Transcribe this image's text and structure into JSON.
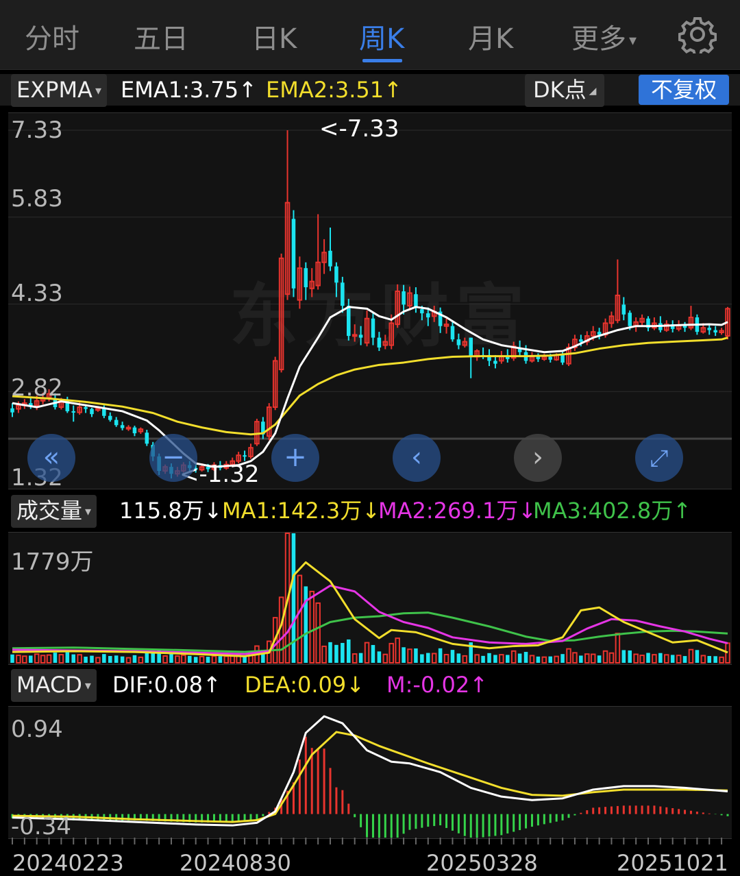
{
  "tabs": [
    {
      "label": "分时",
      "active": false
    },
    {
      "label": "五日",
      "active": false
    },
    {
      "label": "日K",
      "active": false
    },
    {
      "label": "周K",
      "active": true
    },
    {
      "label": "月K",
      "active": false
    },
    {
      "label": "更多",
      "active": false
    }
  ],
  "tab_more_caret": "▾",
  "settings_icon": "gear-icon",
  "main_indicator": {
    "name": "EXPMA",
    "caret": "▾",
    "ema1": "EMA1:3.75",
    "ema1_arrow": "↑",
    "ema2": "EMA2:3.51",
    "ema2_arrow": "↑",
    "dk_label": "DK点",
    "dk_caret": "◢",
    "fq_label": "不复权"
  },
  "price_axis": [
    "7.33",
    "5.83",
    "4.33",
    "2.82",
    "1.32"
  ],
  "high_marker": "<-7.33",
  "low_marker": "<-1.32",
  "watermark": "东方财富",
  "volume_indicator": {
    "name": "成交量",
    "caret": "▾",
    "value": "115.8万",
    "value_arrow": "↓",
    "ma1": "MA1:142.3万",
    "ma1_arrow": "↓",
    "ma2": "MA2:269.1万",
    "ma2_arrow": "↓",
    "ma3": "MA3:402.8万",
    "ma3_arrow": "↑"
  },
  "volume_axis_max": "1779万",
  "macd_indicator": {
    "name": "MACD",
    "caret": "▾",
    "dif": "DIF:0.08",
    "dif_arrow": "↑",
    "dea": "DEA:0.09",
    "dea_arrow": "↓",
    "m": "M:-0.02",
    "m_arrow": "↑"
  },
  "macd_axis": [
    "0.94",
    "-0.34"
  ],
  "x_axis": [
    "20240223",
    "20240830",
    "20250328",
    "20251021"
  ],
  "colors": {
    "up": "#e8342e",
    "down": "#1ce4f0",
    "ema1": "#ffffff",
    "ema2": "#f2de2c",
    "ma2": "#e535e5",
    "ma3": "#3fc24a",
    "accent": "#3a7ee8"
  },
  "chart_data": {
    "type": "candlestick",
    "period": "weekly",
    "ylim": [
      1.32,
      7.33
    ],
    "candles": [
      [
        2.53,
        2.46,
        2.62,
        2.38
      ],
      [
        2.52,
        2.58,
        2.65,
        2.45
      ],
      [
        2.58,
        2.62,
        2.69,
        2.52
      ],
      [
        2.62,
        2.58,
        2.72,
        2.52
      ],
      [
        2.58,
        2.66,
        2.75,
        2.5
      ],
      [
        2.66,
        2.71,
        2.8,
        2.6
      ],
      [
        2.71,
        2.78,
        2.86,
        2.65
      ],
      [
        2.7,
        2.55,
        2.79,
        2.51
      ],
      [
        2.55,
        2.66,
        2.71,
        2.51
      ],
      [
        2.66,
        2.48,
        2.73,
        2.45
      ],
      [
        2.48,
        2.46,
        2.58,
        2.3
      ],
      [
        2.46,
        2.55,
        2.63,
        2.42
      ],
      [
        2.55,
        2.52,
        2.6,
        2.45
      ],
      [
        2.52,
        2.43,
        2.54,
        2.38
      ],
      [
        2.5,
        2.53,
        2.57,
        2.47
      ],
      [
        2.53,
        2.4,
        2.58,
        2.36
      ],
      [
        2.4,
        2.33,
        2.46,
        2.3
      ],
      [
        2.33,
        2.24,
        2.38,
        2.21
      ],
      [
        2.24,
        2.19,
        2.3,
        2.15
      ],
      [
        2.18,
        2.2,
        2.24,
        2.14
      ],
      [
        2.2,
        2.1,
        2.23,
        2.05
      ],
      [
        2.13,
        2.17,
        2.2,
        2.09
      ],
      [
        2.11,
        1.92,
        2.16,
        1.88
      ],
      [
        1.9,
        1.7,
        1.95,
        1.62
      ],
      [
        1.7,
        1.45,
        1.75,
        1.38
      ],
      [
        1.45,
        1.52,
        1.56,
        1.4
      ],
      [
        1.52,
        1.4,
        1.58,
        1.32
      ],
      [
        1.4,
        1.45,
        1.52,
        1.35
      ],
      [
        1.45,
        1.55,
        1.6,
        1.42
      ],
      [
        1.55,
        1.5,
        1.62,
        1.44
      ],
      [
        1.5,
        1.47,
        1.56,
        1.42
      ],
      [
        1.47,
        1.52,
        1.58,
        1.44
      ],
      [
        1.52,
        1.48,
        1.57,
        1.43
      ],
      [
        1.48,
        1.55,
        1.6,
        1.45
      ],
      [
        1.55,
        1.5,
        1.62,
        1.46
      ],
      [
        1.5,
        1.56,
        1.62,
        1.47
      ],
      [
        1.56,
        1.62,
        1.68,
        1.52
      ],
      [
        1.62,
        1.72,
        1.78,
        1.58
      ],
      [
        1.72,
        1.7,
        1.8,
        1.62
      ],
      [
        1.7,
        1.85,
        1.92,
        1.66
      ],
      [
        1.92,
        2.3,
        2.35,
        1.88
      ],
      [
        2.3,
        2.08,
        2.38,
        2.0
      ],
      [
        2.05,
        2.55,
        2.62,
        1.98
      ],
      [
        2.55,
        3.35,
        3.42,
        2.5
      ],
      [
        3.2,
        5.12,
        5.2,
        3.15
      ],
      [
        4.5,
        6.08,
        7.33,
        4.4
      ],
      [
        5.8,
        4.6,
        5.95,
        4.45
      ],
      [
        4.4,
        4.95,
        5.15,
        4.25
      ],
      [
        4.95,
        4.62,
        5.05,
        4.4
      ],
      [
        4.6,
        4.72,
        4.95,
        4.45
      ],
      [
        4.65,
        5.05,
        5.88,
        4.58
      ],
      [
        5.05,
        5.22,
        5.45,
        4.85
      ],
      [
        5.25,
        4.98,
        5.65,
        4.9
      ],
      [
        4.98,
        4.7,
        5.05,
        4.45
      ],
      [
        4.7,
        4.3,
        4.8,
        4.18
      ],
      [
        4.3,
        3.78,
        4.42,
        3.7
      ],
      [
        3.78,
        3.8,
        3.98,
        3.68
      ],
      [
        3.8,
        3.75,
        3.95,
        3.62
      ],
      [
        3.66,
        4.08,
        4.22,
        3.6
      ],
      [
        4.08,
        3.75,
        4.18,
        3.62
      ],
      [
        3.75,
        3.58,
        3.85,
        3.52
      ],
      [
        3.62,
        3.68,
        3.8,
        3.55
      ],
      [
        3.62,
        4.0,
        4.15,
        3.55
      ],
      [
        3.98,
        4.55,
        4.67,
        3.92
      ],
      [
        4.55,
        4.32,
        4.66,
        4.15
      ],
      [
        4.3,
        4.52,
        4.63,
        4.22
      ],
      [
        4.5,
        4.26,
        4.62,
        4.18
      ],
      [
        4.24,
        4.17,
        4.3,
        4.05
      ],
      [
        4.17,
        4.1,
        4.27,
        3.95
      ],
      [
        4.12,
        4.2,
        4.3,
        4.02
      ],
      [
        4.2,
        3.95,
        4.27,
        3.83
      ],
      [
        3.95,
        3.98,
        4.08,
        3.82
      ],
      [
        3.95,
        3.72,
        4.05,
        3.68
      ],
      [
        3.72,
        3.62,
        3.82,
        3.55
      ],
      [
        3.62,
        3.68,
        3.75,
        3.58
      ],
      [
        3.75,
        3.42,
        3.75,
        3.05
      ],
      [
        3.42,
        3.52,
        3.55,
        3.35
      ],
      [
        3.45,
        3.43,
        3.58,
        3.38
      ],
      [
        3.45,
        3.35,
        3.55,
        3.26
      ],
      [
        3.35,
        3.3,
        3.45,
        3.22
      ],
      [
        3.35,
        3.43,
        3.52,
        3.3
      ],
      [
        3.43,
        3.38,
        3.55,
        3.32
      ],
      [
        3.4,
        3.6,
        3.68,
        3.35
      ],
      [
        3.58,
        3.5,
        3.7,
        3.42
      ],
      [
        3.5,
        3.35,
        3.62,
        3.3
      ],
      [
        3.35,
        3.42,
        3.5,
        3.32
      ],
      [
        3.42,
        3.38,
        3.48,
        3.33
      ],
      [
        3.38,
        3.42,
        3.47,
        3.35
      ],
      [
        3.42,
        3.37,
        3.47,
        3.32
      ],
      [
        3.37,
        3.45,
        3.48,
        3.35
      ],
      [
        3.45,
        3.32,
        3.5,
        3.28
      ],
      [
        3.3,
        3.58,
        3.65,
        3.26
      ],
      [
        3.58,
        3.72,
        3.8,
        3.52
      ],
      [
        3.72,
        3.68,
        3.8,
        3.6
      ],
      [
        3.68,
        3.78,
        3.86,
        3.62
      ],
      [
        3.78,
        3.85,
        3.95,
        3.7
      ],
      [
        3.85,
        3.8,
        3.92,
        3.72
      ],
      [
        3.8,
        4.0,
        4.08,
        3.75
      ],
      [
        4.0,
        4.12,
        4.2,
        3.92
      ],
      [
        4.05,
        4.48,
        5.1,
        4.0
      ],
      [
        4.32,
        4.15,
        4.45,
        4.05
      ],
      [
        4.18,
        3.95,
        4.22,
        3.88
      ],
      [
        3.95,
        4.02,
        4.1,
        3.85
      ],
      [
        4.02,
        4.08,
        4.15,
        3.95
      ],
      [
        4.08,
        3.92,
        4.12,
        3.86
      ],
      [
        3.92,
        4.0,
        4.1,
        3.88
      ],
      [
        4.0,
        3.88,
        4.12,
        3.84
      ],
      [
        3.88,
        3.98,
        4.05,
        3.85
      ],
      [
        3.98,
        3.9,
        4.05,
        3.84
      ],
      [
        3.9,
        3.97,
        4.05,
        3.86
      ],
      [
        3.97,
        3.92,
        4.02,
        3.85
      ],
      [
        3.92,
        4.1,
        4.3,
        3.88
      ],
      [
        4.1,
        3.85,
        4.15,
        3.8
      ],
      [
        3.85,
        3.92,
        4.0,
        3.82
      ],
      [
        3.92,
        3.88,
        3.98,
        3.8
      ],
      [
        3.88,
        3.84,
        3.95,
        3.78
      ],
      [
        3.84,
        3.87,
        3.92,
        3.8
      ],
      [
        3.78,
        4.25,
        4.28,
        3.72
      ]
    ],
    "ema1": [
      [
        2.62,
        0
      ],
      [
        2.55,
        4
      ],
      [
        2.65,
        8
      ],
      [
        2.55,
        14
      ],
      [
        2.48,
        18
      ],
      [
        2.32,
        22
      ],
      [
        2.15,
        24
      ],
      [
        1.95,
        26
      ],
      [
        1.75,
        28
      ],
      [
        1.58,
        30
      ],
      [
        1.52,
        33
      ],
      [
        1.55,
        37
      ],
      [
        1.62,
        39
      ],
      [
        1.78,
        41
      ],
      [
        2.1,
        43
      ],
      [
        2.7,
        45
      ],
      [
        3.25,
        47
      ],
      [
        3.75,
        50
      ],
      [
        4.1,
        52
      ],
      [
        4.28,
        55
      ],
      [
        4.25,
        58
      ],
      [
        4.12,
        60
      ],
      [
        4.06,
        62
      ],
      [
        4.2,
        64
      ],
      [
        4.28,
        66
      ],
      [
        4.25,
        68
      ],
      [
        4.1,
        71
      ],
      [
        3.9,
        74
      ],
      [
        3.72,
        77
      ],
      [
        3.62,
        80
      ],
      [
        3.55,
        84
      ],
      [
        3.5,
        87
      ],
      [
        3.52,
        90
      ],
      [
        3.6,
        92
      ],
      [
        3.75,
        95
      ],
      [
        3.88,
        99
      ],
      [
        3.95,
        102
      ],
      [
        3.95,
        105
      ],
      [
        3.97,
        110
      ],
      [
        3.98,
        114
      ],
      [
        3.97,
        116
      ],
      [
        4.02,
        117
      ]
    ],
    "ema2": [
      [
        2.74,
        0
      ],
      [
        2.7,
        6
      ],
      [
        2.64,
        12
      ],
      [
        2.56,
        18
      ],
      [
        2.45,
        23
      ],
      [
        2.3,
        27
      ],
      [
        2.2,
        31
      ],
      [
        2.12,
        35
      ],
      [
        2.08,
        39
      ],
      [
        2.1,
        41
      ],
      [
        2.25,
        43
      ],
      [
        2.5,
        45
      ],
      [
        2.75,
        47
      ],
      [
        2.95,
        50
      ],
      [
        3.1,
        53
      ],
      [
        3.2,
        56
      ],
      [
        3.28,
        60
      ],
      [
        3.32,
        64
      ],
      [
        3.38,
        68
      ],
      [
        3.42,
        72
      ],
      [
        3.43,
        76
      ],
      [
        3.43,
        80
      ],
      [
        3.43,
        84
      ],
      [
        3.44,
        88
      ],
      [
        3.48,
        92
      ],
      [
        3.56,
        96
      ],
      [
        3.62,
        100
      ],
      [
        3.66,
        104
      ],
      [
        3.68,
        108
      ],
      [
        3.7,
        112
      ],
      [
        3.72,
        116
      ],
      [
        3.75,
        117
      ]
    ],
    "volume": {
      "ylim": [
        0,
        1779
      ],
      "unit": "万",
      "ma1": [
        [
          150,
          0
        ],
        [
          160,
          10
        ],
        [
          150,
          20
        ],
        [
          120,
          30
        ],
        [
          90,
          38
        ],
        [
          140,
          42
        ],
        [
          520,
          44
        ],
        [
          1200,
          46
        ],
        [
          1380,
          48
        ],
        [
          1120,
          52
        ],
        [
          600,
          56
        ],
        [
          340,
          60
        ],
        [
          450,
          62
        ],
        [
          420,
          66
        ],
        [
          260,
          72
        ],
        [
          200,
          78
        ],
        [
          230,
          82
        ],
        [
          240,
          86
        ],
        [
          350,
          90
        ],
        [
          720,
          93
        ],
        [
          760,
          96
        ],
        [
          560,
          100
        ],
        [
          420,
          104
        ],
        [
          280,
          108
        ],
        [
          310,
          112
        ],
        [
          142,
          117
        ]
      ],
      "ma2": [
        [
          180,
          0
        ],
        [
          170,
          10
        ],
        [
          160,
          20
        ],
        [
          140,
          30
        ],
        [
          120,
          38
        ],
        [
          160,
          42
        ],
        [
          420,
          45
        ],
        [
          850,
          48
        ],
        [
          1060,
          52
        ],
        [
          980,
          56
        ],
        [
          700,
          60
        ],
        [
          560,
          64
        ],
        [
          480,
          68
        ],
        [
          350,
          72
        ],
        [
          280,
          78
        ],
        [
          260,
          84
        ],
        [
          300,
          90
        ],
        [
          470,
          94
        ],
        [
          600,
          98
        ],
        [
          580,
          102
        ],
        [
          500,
          106
        ],
        [
          430,
          110
        ],
        [
          330,
          114
        ],
        [
          269,
          117
        ]
      ],
      "ma3": [
        [
          200,
          0
        ],
        [
          210,
          10
        ],
        [
          190,
          20
        ],
        [
          170,
          30
        ],
        [
          150,
          38
        ],
        [
          180,
          44
        ],
        [
          400,
          48
        ],
        [
          560,
          52
        ],
        [
          620,
          56
        ],
        [
          640,
          60
        ],
        [
          680,
          64
        ],
        [
          690,
          68
        ],
        [
          620,
          72
        ],
        [
          500,
          78
        ],
        [
          360,
          84
        ],
        [
          300,
          88
        ],
        [
          310,
          92
        ],
        [
          360,
          96
        ],
        [
          400,
          100
        ],
        [
          430,
          104
        ],
        [
          440,
          108
        ],
        [
          430,
          112
        ],
        [
          402,
          117
        ]
      ]
    },
    "macd": {
      "ylim": [
        -0.34,
        0.94
      ],
      "dif": [
        [
          -0.22,
          0
        ],
        [
          -0.24,
          10
        ],
        [
          -0.27,
          20
        ],
        [
          -0.3,
          30
        ],
        [
          -0.31,
          36
        ],
        [
          -0.28,
          40
        ],
        [
          -0.15,
          43
        ],
        [
          0.3,
          46
        ],
        [
          0.75,
          48
        ],
        [
          0.94,
          51
        ],
        [
          0.86,
          54
        ],
        [
          0.55,
          58
        ],
        [
          0.42,
          62
        ],
        [
          0.4,
          65
        ],
        [
          0.3,
          70
        ],
        [
          0.12,
          75
        ],
        [
          0.02,
          80
        ],
        [
          -0.02,
          85
        ],
        [
          0.0,
          90
        ],
        [
          0.1,
          95
        ],
        [
          0.14,
          100
        ],
        [
          0.14,
          105
        ],
        [
          0.12,
          110
        ],
        [
          0.08,
          117
        ]
      ],
      "dea": [
        [
          -0.2,
          0
        ],
        [
          -0.21,
          10
        ],
        [
          -0.24,
          20
        ],
        [
          -0.26,
          30
        ],
        [
          -0.27,
          36
        ],
        [
          -0.25,
          40
        ],
        [
          -0.18,
          43
        ],
        [
          0.15,
          46
        ],
        [
          0.5,
          49
        ],
        [
          0.76,
          53
        ],
        [
          0.72,
          56
        ],
        [
          0.6,
          60
        ],
        [
          0.5,
          64
        ],
        [
          0.4,
          68
        ],
        [
          0.26,
          74
        ],
        [
          0.12,
          80
        ],
        [
          0.04,
          85
        ],
        [
          0.03,
          90
        ],
        [
          0.07,
          95
        ],
        [
          0.1,
          100
        ],
        [
          0.1,
          105
        ],
        [
          0.1,
          110
        ],
        [
          0.09,
          117
        ]
      ]
    }
  }
}
